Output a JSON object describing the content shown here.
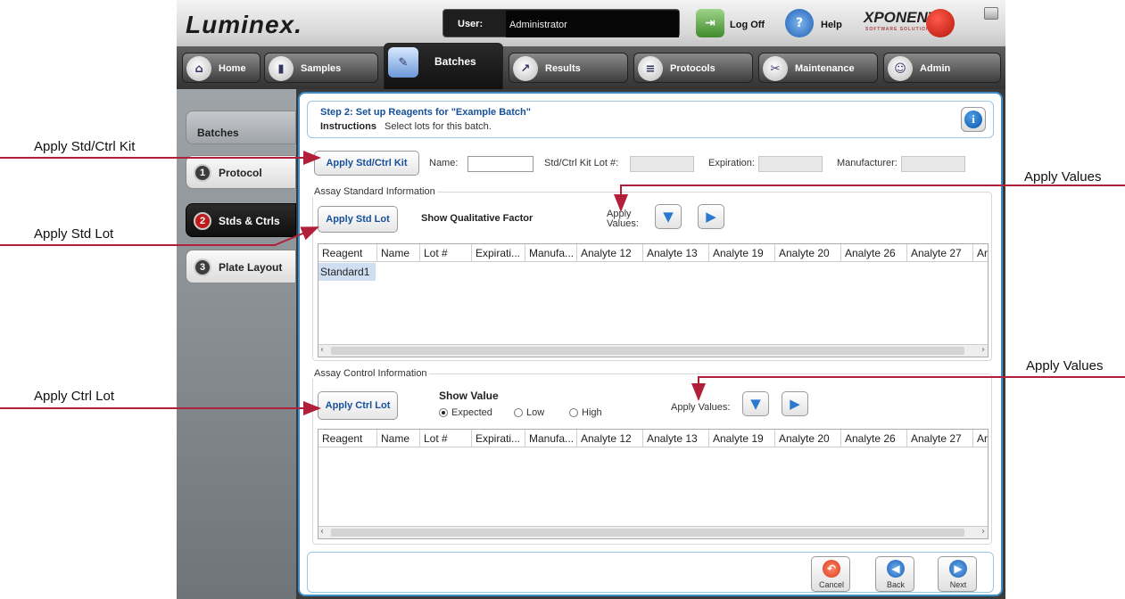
{
  "app": {
    "logo": "Luminex.",
    "user_label": "User:",
    "user_value": "Administrator",
    "logoff_label": "Log Off",
    "help_label": "Help",
    "brand": "XPONENT",
    "brand_sub": "SOFTWARE SOLUTIONS"
  },
  "nav": {
    "tabs": [
      {
        "label": "Home",
        "icon": "home-icon"
      },
      {
        "label": "Samples",
        "icon": "samples-icon"
      },
      {
        "label": "Batches",
        "icon": "batches-icon",
        "active": true
      },
      {
        "label": "Results",
        "icon": "results-icon"
      },
      {
        "label": "Protocols",
        "icon": "protocols-icon"
      },
      {
        "label": "Maintenance",
        "icon": "maintenance-icon"
      },
      {
        "label": "Admin",
        "icon": "admin-icon"
      }
    ]
  },
  "sidebar": {
    "header": "Batches",
    "items": [
      {
        "num": "1",
        "label": "Protocol"
      },
      {
        "num": "2",
        "label": "Stds & Ctrls",
        "active": true
      },
      {
        "num": "3",
        "label": "Plate Layout"
      }
    ]
  },
  "step": {
    "title": "Step 2: Set up Reagents for \"Example Batch\"",
    "instructions_label": "Instructions",
    "instructions_text": "Select lots for this batch."
  },
  "kit": {
    "button": "Apply Std/Ctrl Kit",
    "name_label": "Name:",
    "lot_label": "Std/Ctrl Kit Lot #:",
    "expiration_label": "Expiration:",
    "manufacturer_label": "Manufacturer:"
  },
  "standard": {
    "group_title": "Assay Standard Information",
    "button": "Apply Std Lot",
    "qualitative_label": "Show Qualitative Factor",
    "apply_values_label": "Apply Values:",
    "columns": [
      "Reagent",
      "Name",
      "Lot #",
      "Expirati...",
      "Manufa...",
      "Analyte 12",
      "Analyte 13",
      "Analyte 19",
      "Analyte 20",
      "Analyte 26",
      "Analyte 27",
      "Ar"
    ],
    "rows": [
      [
        "Standard1"
      ]
    ]
  },
  "control": {
    "group_title": "Assay Control Information",
    "button": "Apply Ctrl Lot",
    "show_value_label": "Show Value",
    "options": [
      "Expected",
      "Low",
      "High"
    ],
    "selected": "Expected",
    "apply_values_label": "Apply Values:",
    "columns": [
      "Reagent",
      "Name",
      "Lot #",
      "Expirati...",
      "Manufa...",
      "Analyte 12",
      "Analyte 13",
      "Analyte 19",
      "Analyte 20",
      "Analyte 26",
      "Analyte 27",
      "Ar"
    ]
  },
  "footer": {
    "cancel": "Cancel",
    "back": "Back",
    "next": "Next"
  },
  "callouts": {
    "std_ctrl_kit": "Apply Std/Ctrl Kit",
    "std_lot": "Apply Std Lot",
    "ctrl_lot": "Apply Ctrl Lot",
    "apply_values_1": "Apply Values",
    "apply_values_2": "Apply Values"
  },
  "colors": {
    "accent": "#17509a",
    "callout_line": "#b0203a",
    "frame": "#3d8cc7"
  }
}
